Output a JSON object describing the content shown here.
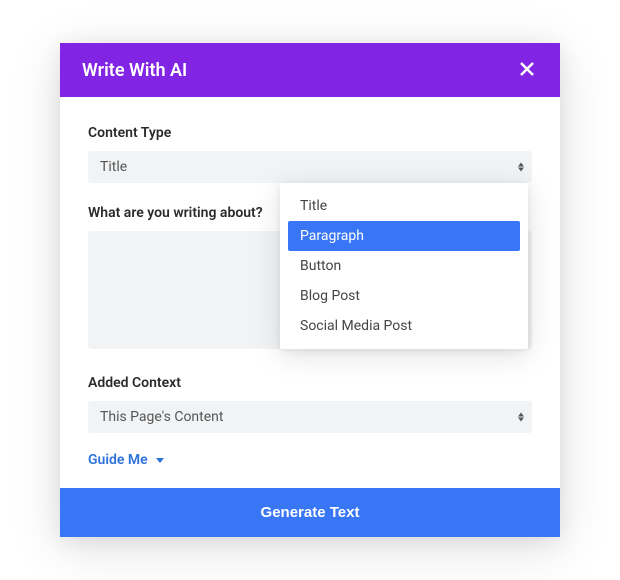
{
  "header": {
    "title": "Write With AI"
  },
  "content_type": {
    "label": "Content Type",
    "value": "Title",
    "options": [
      "Title",
      "Paragraph",
      "Button",
      "Blog Post",
      "Social Media Post"
    ],
    "hovered_index": 1
  },
  "prompt": {
    "label": "What are you writing about?",
    "value": ""
  },
  "added_context": {
    "label": "Added Context",
    "value": "This Page's Content"
  },
  "guide": {
    "label": "Guide Me"
  },
  "footer": {
    "generate_label": "Generate Text"
  },
  "colors": {
    "header_bg": "#8224e3",
    "primary_btn": "#3876f6",
    "link": "#2d72d9"
  }
}
